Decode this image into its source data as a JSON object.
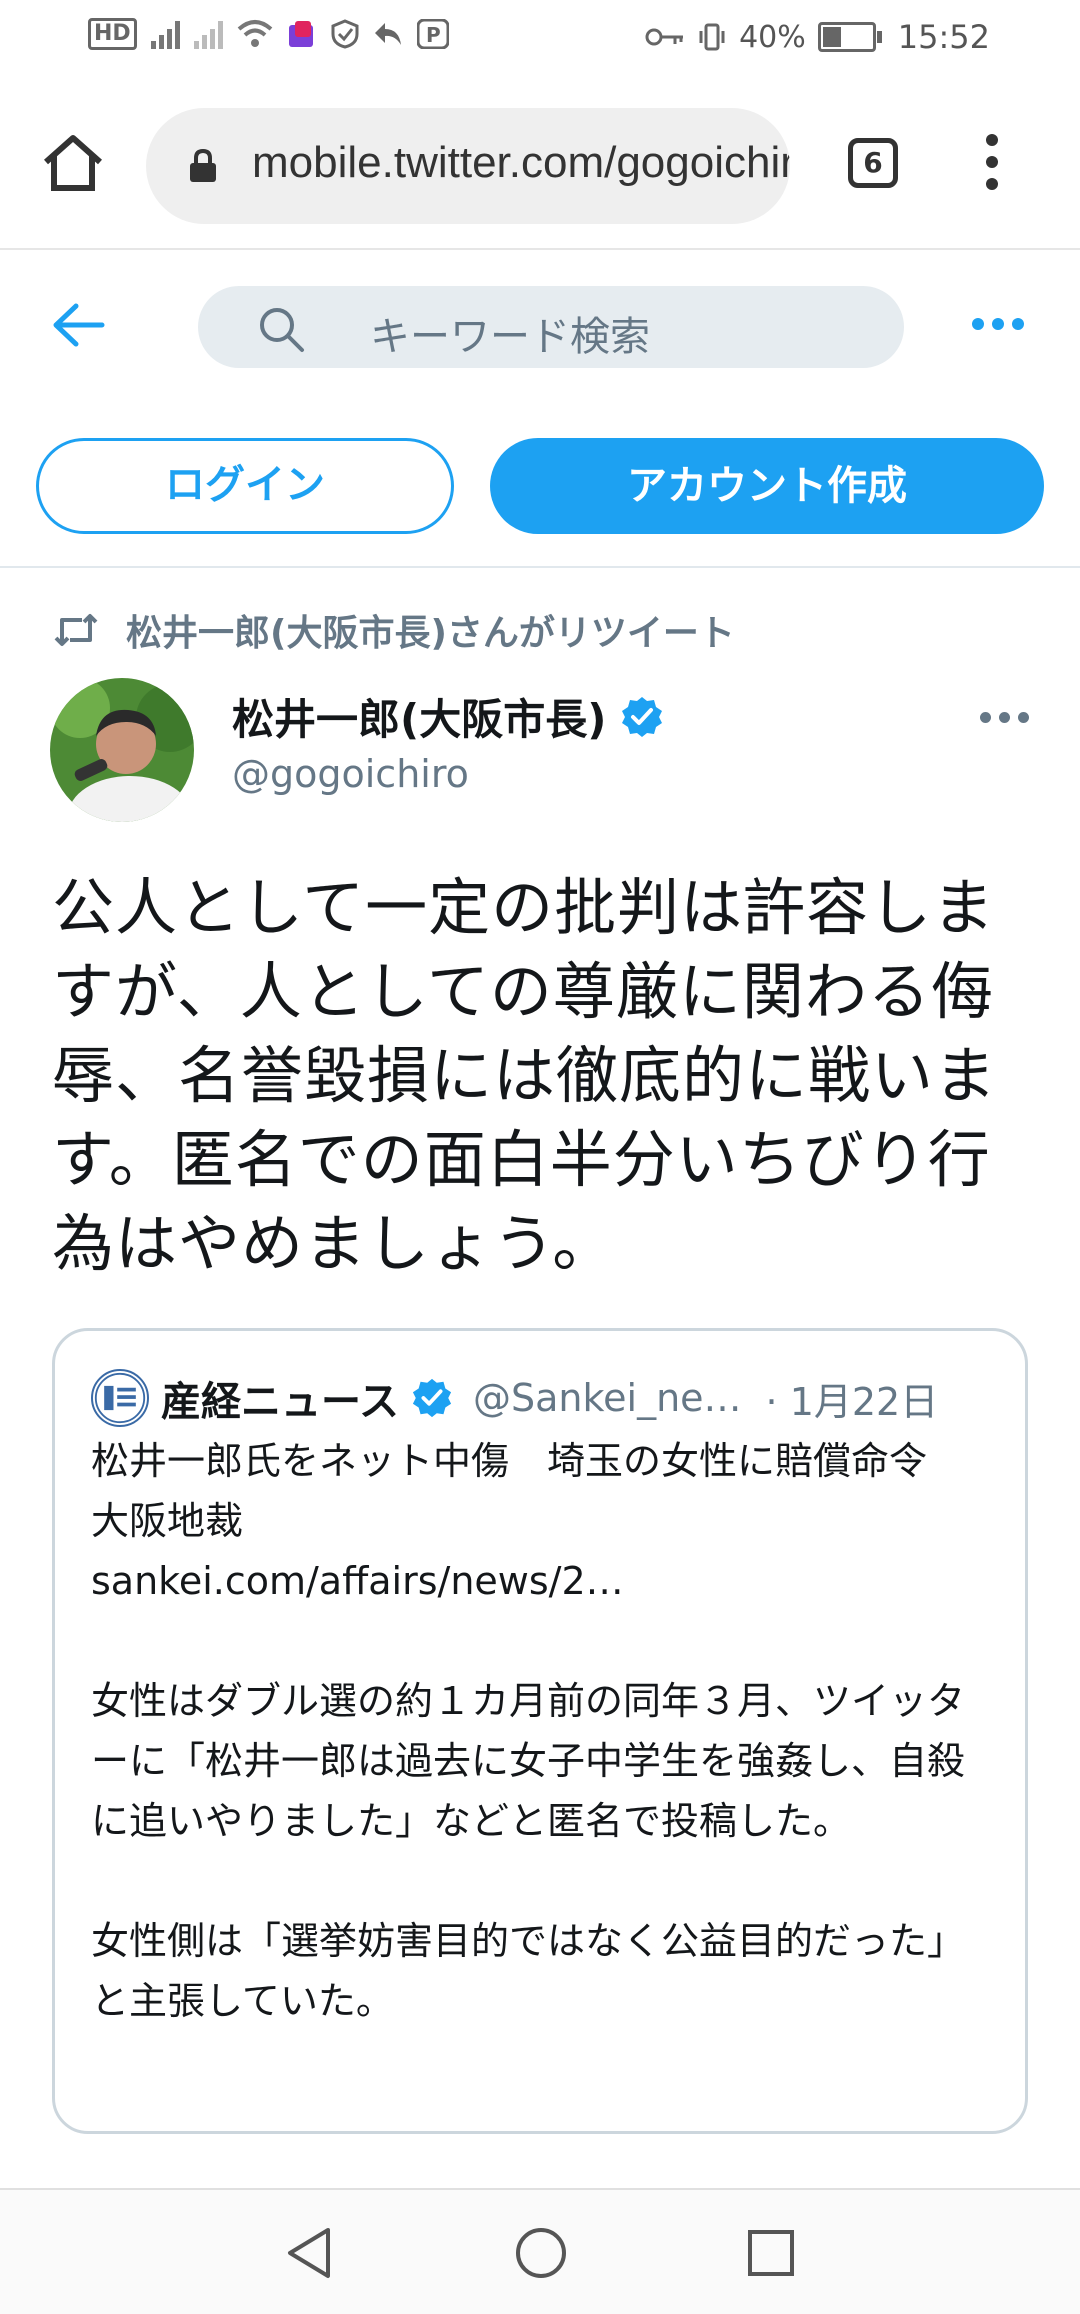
{
  "status_bar": {
    "hd_label": "HD",
    "battery_text": "40%",
    "time": "15:52"
  },
  "browser": {
    "url": "mobile.twitter.com/gogoichiro",
    "tab_count": "6"
  },
  "header": {
    "search_placeholder": "キーワード検索"
  },
  "auth": {
    "login_label": "ログイン",
    "signup_label": "アカウント作成"
  },
  "tweet": {
    "retweet_context": "松井一郎(大阪市長)さんがリツイート",
    "author_name": "松井一郎(大阪市長)",
    "author_handle": "@gogoichiro",
    "text": "公人として一定の批判は許容しますが、人としての尊厳に関わる侮辱、名誉毀損には徹底的に戦います。匿名での面白半分いちびり行為はやめましょう。"
  },
  "quoted_tweet": {
    "name": "産経ニュース",
    "handle": "@Sankei_ne…",
    "date": "· 1月22日",
    "line1": "松井一郎氏をネット中傷　埼玉の女性に賠償命令　大阪地裁",
    "link": "sankei.com/affairs/news/2…",
    "paragraph2": "女性はダブル選の約１カ月前の同年３月、ツイッターに「松井一郎は過去に女子中学生を強姦し、自殺に追いやりました」などと匿名で投稿した。",
    "paragraph3": "女性側は「選挙妨害目的ではなく公益目的だった」と主張していた。"
  },
  "colors": {
    "accent": "#1da1f2",
    "secondary_text": "#657786",
    "border": "#ccd6dd"
  }
}
